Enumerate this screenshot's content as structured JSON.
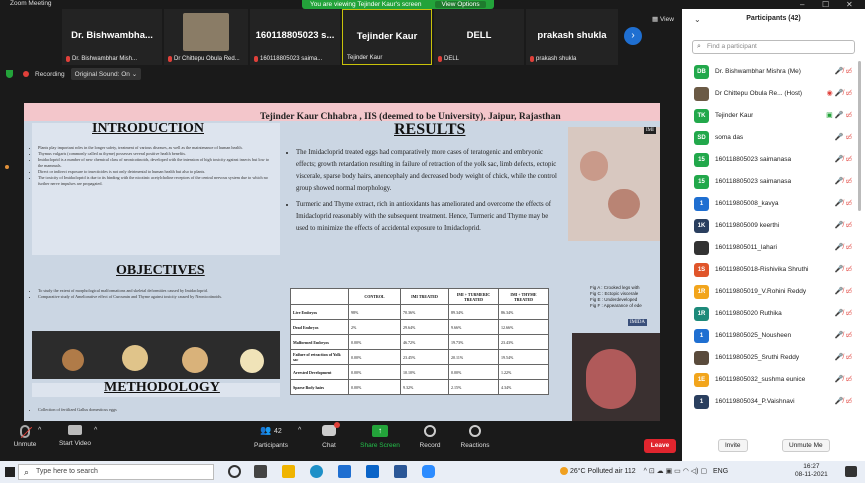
{
  "window": {
    "title": "Zoom Meeting"
  },
  "banner": {
    "viewing": "You are viewing Tejinder Kaur's screen",
    "options": "View Options"
  },
  "view_label": "View",
  "tiles": [
    {
      "name": "Dr. Bishwambha...",
      "sub": "Dr. Bishwambhar Mish..."
    },
    {
      "name": "",
      "sub": "Dr Chittepu Obula Red..."
    },
    {
      "name": "160118805023 s...",
      "sub": "160118805023 saima..."
    },
    {
      "name": "Tejinder Kaur",
      "sub": "Tejinder Kaur"
    },
    {
      "name": "DELL",
      "sub": "DELL"
    },
    {
      "name": "prakash shukla",
      "sub": "prakash shukla"
    }
  ],
  "status": {
    "recording": "Recording",
    "original_sound": "Original Sound: On"
  },
  "slide": {
    "authors": "Tejinder Kaur Chhabra , IIS (deemed to be University), Jaipur, Rajasthan",
    "introduction": "INTRODUCTION",
    "intro_bullets": [
      "Plants play important roles in the longer safety, treatment of various diseases, as well as the maintenance of human health.",
      "Thymus vulgaris (commonly called as thyme) possesses several positive health benefits.",
      "Imidacloprid is a number of new chemical class of neonicotinoids, developed with the intension of high toxicity against insects but low to the mammals.",
      "Direct or indirect exposure to insecticides is not only detrimental to human health but also to plants.",
      "The toxicity of Imidacloprid is due to its binding with the nicotinic acetylcholine receptors of the central nervous system due to which no further nerve impulses are propagated."
    ],
    "objectives": "OBJECTIVES",
    "obj_bullets": [
      "To study the extent of morphological malformations and skeletal deformities caused by Imidacloprid.",
      "Comparative study of Ameliorative effect of Curcumin and Thyme against toxicity caused by Neonicotinoids."
    ],
    "methodology": "METHODOLOGY",
    "method_bullets": [
      "Collection of fertilized Gallus domesticus eggs"
    ],
    "results": "RESULTS",
    "results_bullets": [
      "The Imidacloprid treated eggs had comparatively more cases of teratogenic and embryonic effects; growth retardation resulting in failure of retraction of the yolk sac, limb defects, ectopic viscerale, sparse body hairs, anencephaly and decreased body weight of chick, while the control group showed normal morphology.",
      "Turmeric and Thyme extract, rich in antioxidants has ameliorated and overcome the effects of Imidacloprid reasonably with the subsequent treatment. Hence, Turmeric and Thyme may be used to minimize the effects of accidental exposure to Imidacloprid."
    ],
    "table": {
      "headers": [
        "",
        "CONTROL",
        "IMI TREATED",
        "IMI + TURMERIC TREATED",
        "IMI + THYME TREATED"
      ],
      "rows": [
        [
          "Live Embryos",
          "98%",
          "70.36%",
          "89.34%",
          "86.34%"
        ],
        [
          "Dead Embryos",
          "2%",
          "29.64%",
          "9.66%",
          "12.66%"
        ],
        [
          "Malformed Embryos",
          "0.00%",
          "46.72%",
          "19.73%",
          "23.43%"
        ],
        [
          "Failure of retraction of Yolk sac",
          "0.00%",
          "23.45%",
          "20.11%",
          "19.54%"
        ],
        [
          "Arrested Development",
          "0.00%",
          "10.10%",
          "0.00%",
          "1.22%"
        ],
        [
          "Sparse Body hairs",
          "0.00%",
          "9.32%",
          "2.15%",
          "4.34%"
        ]
      ]
    },
    "fig_captions": [
      "Fig A : Crooked legs with",
      "Fig C : Ectopic viscerale",
      "Fig E : Underdeveloped",
      "Fig F : Appearance of ede"
    ],
    "img_tag_top": "IMI",
    "img_tag_mid": "IMIDA"
  },
  "dock": {
    "unmute": "Unmute",
    "start_video": "Start Video",
    "participants": "Participants",
    "participants_count": "42",
    "chat": "Chat",
    "share_screen": "Share Screen",
    "record": "Record",
    "reactions": "Reactions",
    "leave": "Leave"
  },
  "panel": {
    "title": "Participants (42)",
    "search_placeholder": "Find a participant",
    "participants": [
      {
        "initials": "DB",
        "color": "#22a84b",
        "name": "Dr. Bishwambhar Mishra (Me)"
      },
      {
        "initials": "",
        "color": "#6b5a45",
        "name": "Dr Chittepu Obula Re... (Host)"
      },
      {
        "initials": "TK",
        "color": "#22a84b",
        "name": "Tejinder Kaur"
      },
      {
        "initials": "SD",
        "color": "#22a84b",
        "name": "soma das"
      },
      {
        "initials": "15",
        "color": "#22a84b",
        "name": "160118805023 saimanasa"
      },
      {
        "initials": "15",
        "color": "#22a84b",
        "name": "160118805023 saimanasa"
      },
      {
        "initials": "1",
        "color": "#1f6fd1",
        "name": "160119805008_kavya"
      },
      {
        "initials": "1K",
        "color": "#2a3f5f",
        "name": "160119805009 keerthi"
      },
      {
        "initials": "",
        "color": "#333333",
        "name": "160119805011_lahari"
      },
      {
        "initials": "1S",
        "color": "#e0552a",
        "name": "160119805018-Rishivika Shruthi"
      },
      {
        "initials": "1R",
        "color": "#f2a51c",
        "name": "160119805019_V.Rohini Reddy"
      },
      {
        "initials": "1R",
        "color": "#1d8a7a",
        "name": "160119805020 Ruthika"
      },
      {
        "initials": "1",
        "color": "#1f6fd1",
        "name": "160119805025_Nousheen"
      },
      {
        "initials": "",
        "color": "#5a4b3c",
        "name": "160119805025_Sruthi Reddy"
      },
      {
        "initials": "1E",
        "color": "#f2a51c",
        "name": "160119805032_sushma eunice"
      },
      {
        "initials": "1",
        "color": "#2a3f5f",
        "name": "160119805034_P.Vaishnavi"
      }
    ],
    "invite": "Invite",
    "mute_me": "Unmute Me"
  },
  "taskbar": {
    "search_placeholder": "Type here to search",
    "weather": "26°C  Polluted air 112",
    "lang": "ENG",
    "time": "16:27",
    "date": "08-11-2021"
  }
}
